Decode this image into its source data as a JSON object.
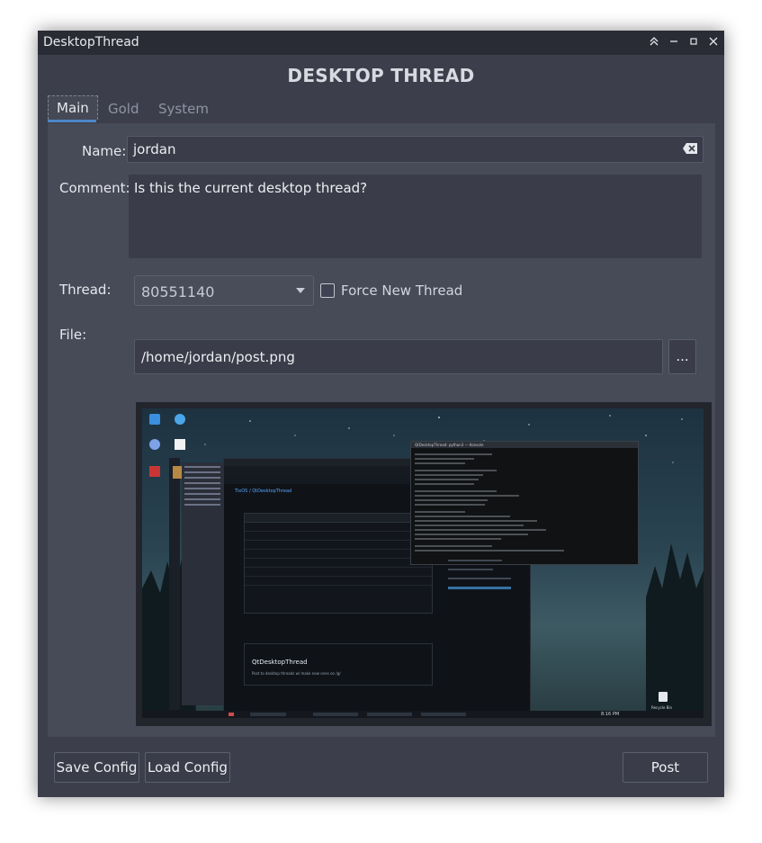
{
  "window": {
    "title": "DesktopThread",
    "controls": [
      "keep-above",
      "minimize",
      "maximize",
      "close"
    ]
  },
  "app": {
    "heading": "DESKTOP THREAD"
  },
  "tabs": [
    {
      "label": "Main",
      "active": true
    },
    {
      "label": "Gold",
      "active": false
    },
    {
      "label": "System",
      "active": false
    }
  ],
  "form": {
    "name_label": "Name:",
    "name_value": "jordan",
    "comment_label": "Comment:",
    "comment_value": "Is this the current desktop thread?",
    "thread_label": "Thread:",
    "thread_value": "80551140",
    "force_new_label": "Force New Thread",
    "force_new_checked": false,
    "file_label": "File:",
    "file_value": "/home/jordan/post.png",
    "browse_label": "..."
  },
  "preview": {
    "browser_repo": "QtDesktopThread",
    "browser_path": "TixOS / QtDesktopThread",
    "readme_title": "QtDesktopThread",
    "readme_text": "Post to desktop threads w/ make new ones on /g/",
    "terminal_title": "QtDesktopThread: python3 — Konsole",
    "clock": "8:16 PM",
    "recycle_bin": "Recycle Bin"
  },
  "footer": {
    "save_config": "Save Config",
    "load_config": "Load Config",
    "post": "Post"
  },
  "colors": {
    "window_bg": "#3c3f4b",
    "panel_bg": "#474a57",
    "accent": "#4e86c8"
  }
}
